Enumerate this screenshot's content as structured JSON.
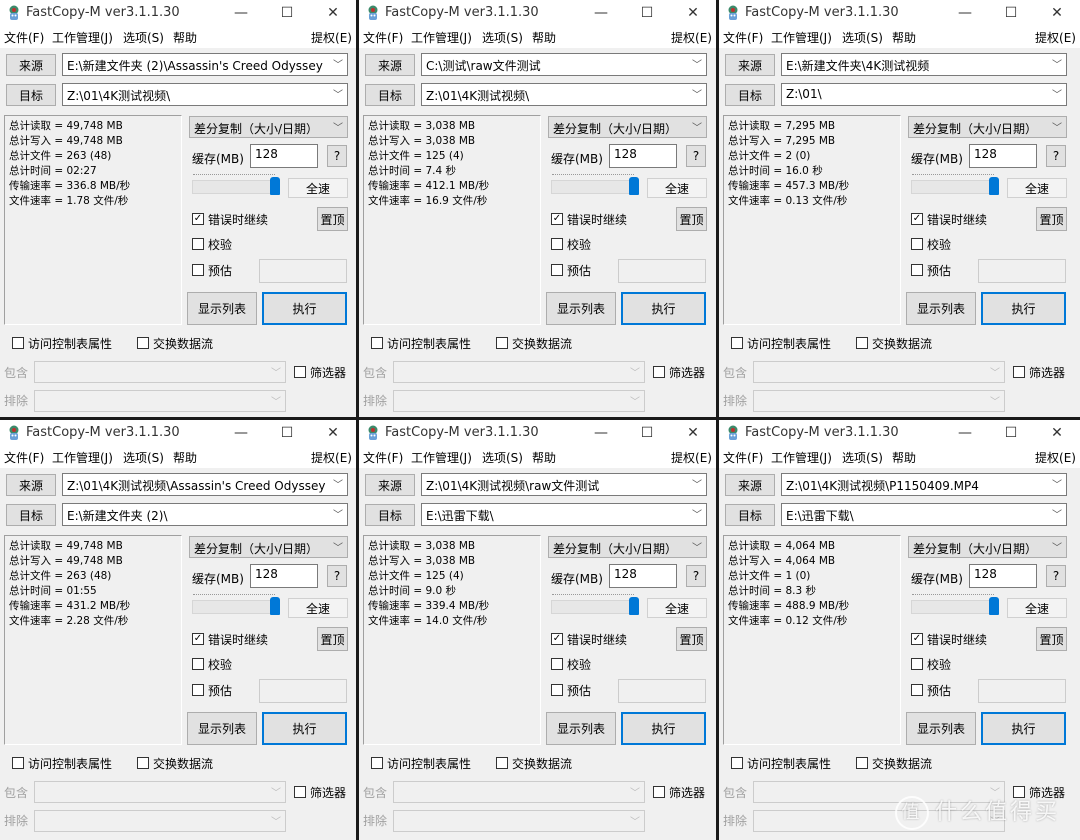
{
  "common": {
    "title": "FastCopy-M ver3.1.1.30",
    "titlebar_buttons": {
      "minimize": "—",
      "maximize": "☐",
      "close": "✕"
    },
    "menu": [
      "文件(F)",
      "工作管理(J)",
      "选项(S)",
      "帮助"
    ],
    "menu_right": "提权(E)",
    "source_button": "来源",
    "target_button": "目标",
    "mode": "差分复制（大小/日期）",
    "buffer_label": "缓存(MB)",
    "buffer_value": "128",
    "help_button": "?",
    "fullspeed_button": "全速",
    "topmost_button": "置顶",
    "continue_on_error": {
      "label": "错误时继续",
      "checked": true
    },
    "verify": {
      "label": "校验",
      "checked": false
    },
    "estimate": {
      "label": "预估",
      "checked": false
    },
    "show_list_button": "显示列表",
    "execute_button": "执行",
    "acl": {
      "label": "访问控制表属性",
      "checked": false
    },
    "streams": {
      "label": "交换数据流",
      "checked": false
    },
    "include_label": "包含",
    "exclude_label": "排除",
    "filter": {
      "label": "筛选器",
      "checked": false
    },
    "speed_slider_fraction": 1.0,
    "check_mark": "✓",
    "chevron": "﹀"
  },
  "windows": [
    {
      "source": "E:\\新建文件夹 (2)\\Assassin's Creed Odyssey",
      "target": "Z:\\01\\4K测试视频\\",
      "stats": [
        "总计读取 = 49,748 MB",
        "总计写入 = 49,748 MB",
        "总计文件 = 263 (48)",
        "总计时间 = 02:27",
        "传输速率 = 336.8 MB/秒",
        "文件速率 = 1.78 文件/秒"
      ]
    },
    {
      "source": "C:\\测试\\raw文件测试",
      "target": "Z:\\01\\4K测试视频\\",
      "stats": [
        "总计读取 = 3,038 MB",
        "总计写入 = 3,038 MB",
        "总计文件 = 125 (4)",
        "总计时间 = 7.4 秒",
        "传输速率 = 412.1 MB/秒",
        "文件速率 = 16.9 文件/秒"
      ]
    },
    {
      "source": "E:\\新建文件夹\\4K测试视频",
      "target": "Z:\\01\\",
      "stats": [
        "总计读取 = 7,295 MB",
        "总计写入 = 7,295 MB",
        "总计文件 = 2 (0)",
        "总计时间 = 16.0 秒",
        "传输速率 = 457.3 MB/秒",
        "文件速率 = 0.13 文件/秒"
      ]
    },
    {
      "source": "Z:\\01\\4K测试视频\\Assassin's Creed Odyssey",
      "target": "E:\\新建文件夹 (2)\\",
      "stats": [
        "总计读取 = 49,748 MB",
        "总计写入 = 49,748 MB",
        "总计文件 = 263 (48)",
        "总计时间 = 01:55",
        "传输速率 = 431.2 MB/秒",
        "文件速率 = 2.28 文件/秒"
      ]
    },
    {
      "source": "Z:\\01\\4K测试视频\\raw文件测试",
      "target": "E:\\迅雷下载\\",
      "stats": [
        "总计读取 = 3,038 MB",
        "总计写入 = 3,038 MB",
        "总计文件 = 125 (4)",
        "总计时间 = 9.0 秒",
        "传输速率 = 339.4 MB/秒",
        "文件速率 = 14.0 文件/秒"
      ]
    },
    {
      "source": "Z:\\01\\4K测试视频\\P1150409.MP4",
      "target": "E:\\迅雷下载\\",
      "stats": [
        "总计读取 = 4,064 MB",
        "总计写入 = 4,064 MB",
        "总计文件 = 1 (0)",
        "总计时间 = 8.3 秒",
        "传输速率 = 488.9 MB/秒",
        "文件速率 = 0.12 文件/秒"
      ]
    }
  ],
  "watermark": {
    "circle": "值",
    "text": "什么值得买"
  }
}
